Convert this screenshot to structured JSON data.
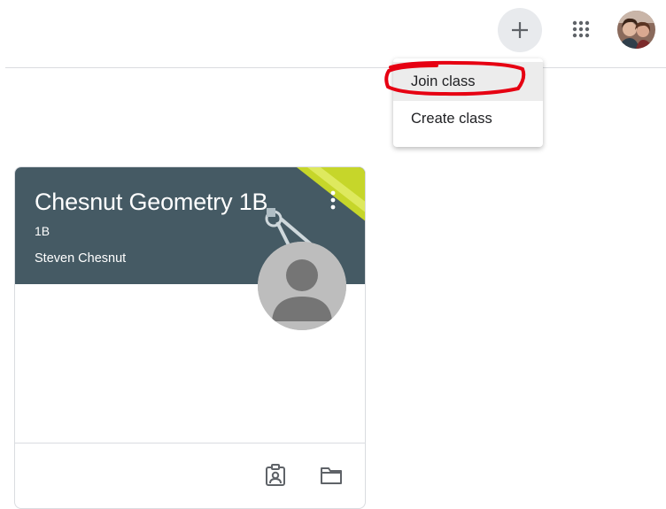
{
  "header": {
    "add_icon": "plus-icon",
    "apps_icon": "apps-grid-icon",
    "avatar_icon": "user-avatar"
  },
  "menu": {
    "items": [
      {
        "label": "Join class"
      },
      {
        "label": "Create class"
      }
    ],
    "highlight_color": "#e60012"
  },
  "class_card": {
    "title": "Chesnut Geometry 1B",
    "section": "1B",
    "teacher": "Steven Chesnut",
    "header_color": "#455a64",
    "accent_color": "#c6d62a",
    "more_icon": "more-vert-icon",
    "footer_icons": [
      "assignment-ind-icon",
      "folder-icon"
    ]
  }
}
